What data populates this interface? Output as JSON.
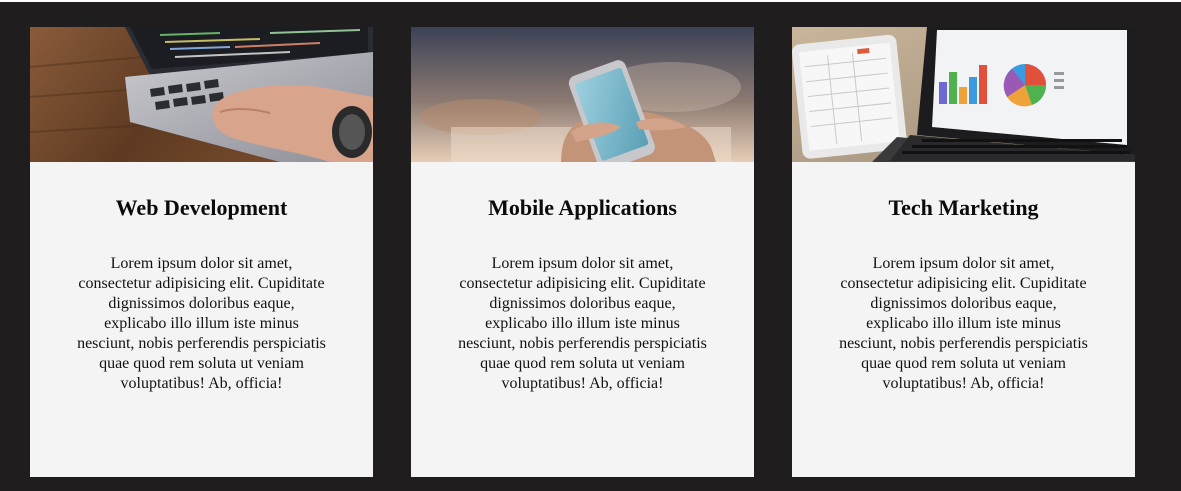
{
  "cards": [
    {
      "image": "laptop-coding-photo",
      "title": "Web Development",
      "text": "Lorem ipsum dolor sit amet, consectetur adipisicing elit. Cupiditate dignissimos doloribus eaque, explicabo illo illum iste minus nesciunt, nobis perferendis perspiciatis quae quod rem soluta ut veniam voluptatibus! Ab, officia!"
    },
    {
      "image": "smartphone-in-hand-photo",
      "title": "Mobile Applications",
      "text": "Lorem ipsum dolor sit amet, consectetur adipisicing elit. Cupiditate dignissimos doloribus eaque, explicabo illo illum iste minus nesciunt, nobis perferendis perspiciatis quae quod rem soluta ut veniam voluptatibus! Ab, officia!"
    },
    {
      "image": "tablet-laptop-charts-photo",
      "title": "Tech Marketing",
      "text": "Lorem ipsum dolor sit amet, consectetur adipisicing elit. Cupiditate dignissimos doloribus eaque, explicabo illo illum iste minus nesciunt, nobis perferendis perspiciatis quae quod rem soluta ut veniam voluptatibus! Ab, officia!"
    }
  ],
  "colors": {
    "background": "#1f1d1e",
    "card": "#f4f4f4",
    "text": "#111111"
  }
}
